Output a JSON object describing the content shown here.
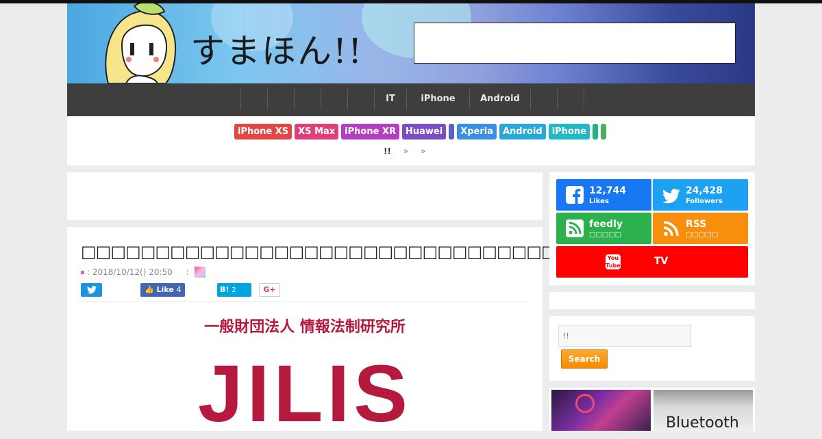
{
  "site": {
    "logo_text": "すまほん!!"
  },
  "nav": {
    "items": [
      "",
      "",
      "",
      "",
      "",
      "IT",
      "iPhone",
      "Android",
      "",
      ""
    ]
  },
  "tags": [
    {
      "label": "iPhone XS",
      "color": "#e04848"
    },
    {
      "label": "XS Max",
      "color": "#e0407a"
    },
    {
      "label": "iPhone XR",
      "color": "#b13fc0"
    },
    {
      "label": "Huawei",
      "color": "#7a4ec4"
    },
    {
      "label": "",
      "color": "#5a60c8"
    },
    {
      "label": "Xperia",
      "color": "#3a8fe0"
    },
    {
      "label": "Android",
      "color": "#2aa8d8"
    },
    {
      "label": "iPhone",
      "color": "#21b8c8"
    },
    {
      "label": "",
      "color": "#26b08a"
    },
    {
      "label": "",
      "color": "#48b060"
    }
  ],
  "breadcrumb": {
    "home": "!!",
    "sep1": "»",
    "sep2": "»"
  },
  "article": {
    "title": "□□□□□□□□□□□□□□□□□□□□□□□□□□□□□□□□□",
    "date": ": 2018/10/12() 20:50",
    "author_sep": ":",
    "share": {
      "like_label": "Like",
      "like_count": "4",
      "hatena_label": "B!",
      "hatena_count": "2",
      "gplus_label": "G+"
    },
    "image_subtitle": "一般財団法人 情報法制研究所",
    "image_logo": "JILIS"
  },
  "sidebar": {
    "facebook": {
      "count": "12,744",
      "label": "Likes"
    },
    "twitter": {
      "count": "24,428",
      "label": "Followers"
    },
    "feedly": {
      "name": "feedly",
      "label": "□□□□□"
    },
    "rss": {
      "name": "RSS",
      "label": "□□□□□"
    },
    "youtube": {
      "icon_text": "You Tube",
      "label": "TV"
    },
    "search": {
      "placeholder": "!!",
      "button": "Search"
    },
    "thumb2_text": "Bluetooth"
  }
}
